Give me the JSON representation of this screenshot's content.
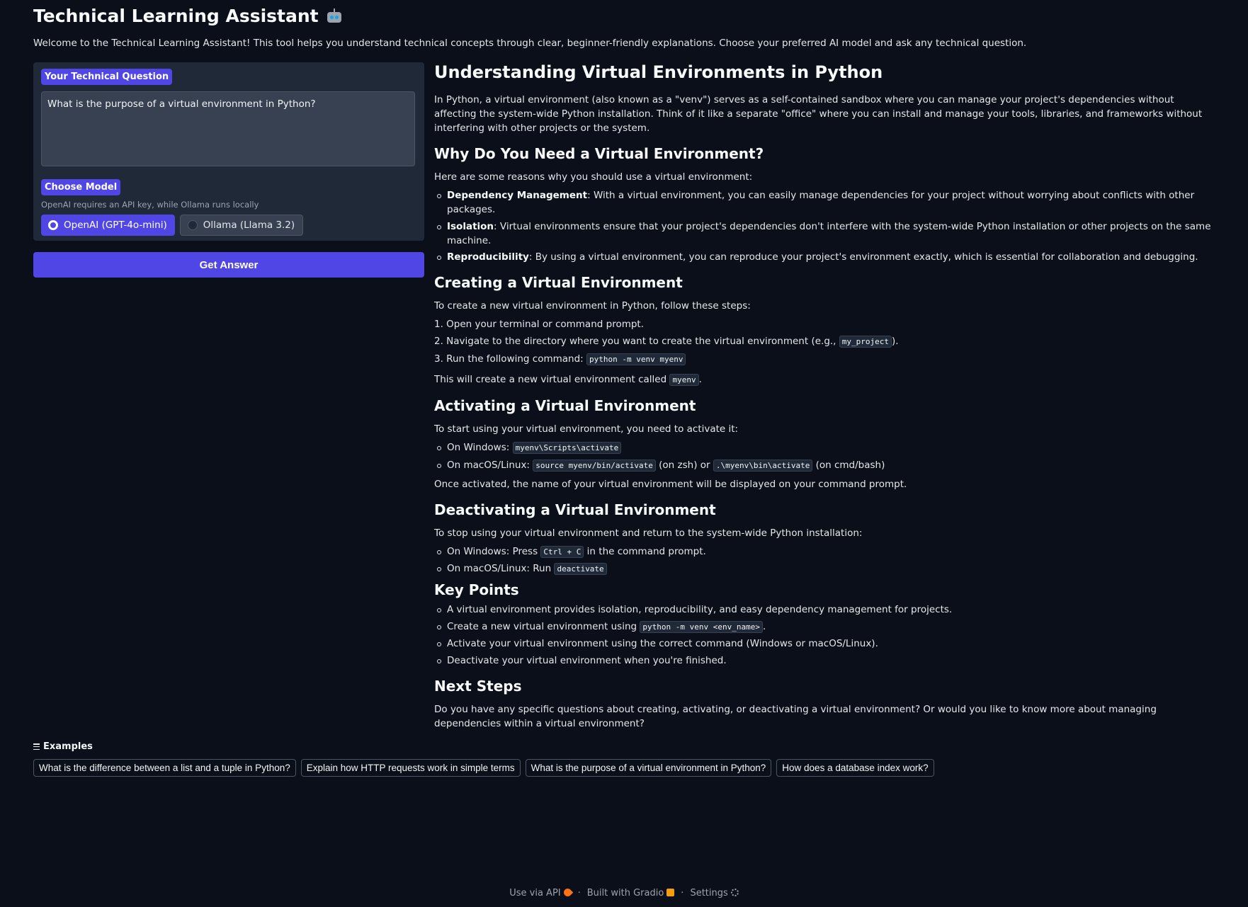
{
  "header": {
    "title": "Technical Learning Assistant",
    "intro": "Welcome to the Technical Learning Assistant! This tool helps you understand technical concepts through clear, beginner-friendly explanations. Choose your preferred AI model and ask any technical question."
  },
  "question": {
    "label": "Your Technical Question",
    "value": "What is the purpose of a virtual environment in Python?"
  },
  "model": {
    "label": "Choose Model",
    "info": "OpenAI requires an API key, while Ollama runs locally",
    "options": [
      "OpenAI (GPT-4o-mini)",
      "Ollama (Llama 3.2)"
    ],
    "selected": "OpenAI (GPT-4o-mini)"
  },
  "submit_label": "Get Answer",
  "answer": {
    "title": "Understanding Virtual Environments in Python",
    "intro": "In Python, a virtual environment (also known as a \"venv\") serves as a self-contained sandbox where you can manage your project's dependencies without affecting the system-wide Python installation. Think of it like a separate \"office\" where you can install and manage your tools, libraries, and frameworks without interfering with other projects or the system.",
    "why": {
      "heading": "Why Do You Need a Virtual Environment?",
      "lead": "Here are some reasons why you should use a virtual environment:",
      "items": [
        {
          "term": "Dependency Management",
          "text": ": With a virtual environment, you can easily manage dependencies for your project without worrying about conflicts with other packages."
        },
        {
          "term": "Isolation",
          "text": ": Virtual environments ensure that your project's dependencies don't interfere with the system-wide Python installation or other projects on the same machine."
        },
        {
          "term": "Reproducibility",
          "text": ": By using a virtual environment, you can reproduce your project's environment exactly, which is essential for collaboration and debugging."
        }
      ]
    },
    "create": {
      "heading": "Creating a Virtual Environment",
      "lead": "To create a new virtual environment in Python, follow these steps:",
      "step1": "1. Open your terminal or command prompt.",
      "step2_a": "2. Navigate to the directory where you want to create the virtual environment (e.g., ",
      "step2_code": "my_project",
      "step2_b": ").",
      "step3_a": "3. Run the following command: ",
      "step3_code": "python -m venv myenv",
      "result_a": "This will create a new virtual environment called ",
      "result_code": "myenv",
      "result_b": "."
    },
    "activate": {
      "heading": "Activating a Virtual Environment",
      "lead": "To start using your virtual environment, you need to activate it:",
      "win_a": "On Windows: ",
      "win_code": "myenv\\Scripts\\activate",
      "mac_a": "On macOS/Linux: ",
      "mac_code1": "source myenv/bin/activate",
      "mac_b": " (on zsh) or ",
      "mac_code2": ".\\myenv\\bin\\activate",
      "mac_c": " (on cmd/bash)",
      "after": "Once activated, the name of your virtual environment will be displayed on your command prompt."
    },
    "deactivate": {
      "heading": "Deactivating a Virtual Environment",
      "lead": "To stop using your virtual environment and return to the system-wide Python installation:",
      "win_a": "On Windows: Press ",
      "win_code": "Ctrl + C",
      "win_b": " in the command prompt.",
      "mac_a": "On macOS/Linux: Run ",
      "mac_code": "deactivate"
    },
    "key_points": {
      "heading": "Key Points",
      "p1": "A virtual environment provides isolation, reproducibility, and easy dependency management for projects.",
      "p2_a": "Create a new virtual environment using ",
      "p2_code": "python -m venv <env_name>",
      "p2_b": ".",
      "p3": "Activate your virtual environment using the correct command (Windows or macOS/Linux).",
      "p4": "Deactivate your virtual environment when you're finished."
    },
    "next": {
      "heading": "Next Steps",
      "text": "Do you have any specific questions about creating, activating, or deactivating a virtual environment? Or would you like to know more about managing dependencies within a virtual environment?"
    }
  },
  "examples": {
    "label": "Examples",
    "items": [
      "What is the difference between a list and a tuple in Python?",
      "Explain how HTTP requests work in simple terms",
      "What is the purpose of a virtual environment in Python?",
      "How does a database index work?"
    ]
  },
  "footer": {
    "api": "Use via API",
    "sep": "·",
    "built": "Built with Gradio",
    "settings": "Settings"
  }
}
